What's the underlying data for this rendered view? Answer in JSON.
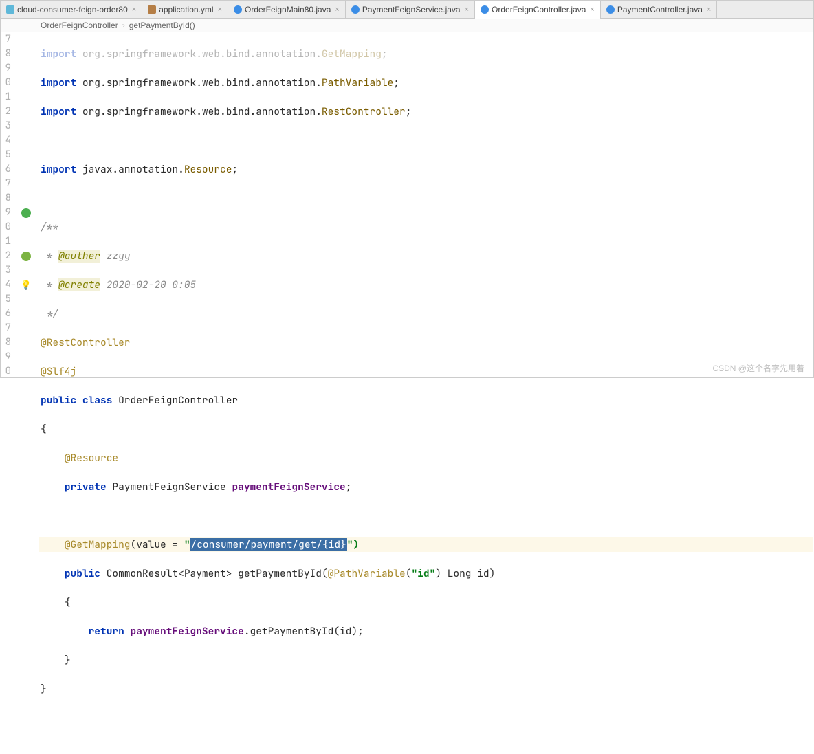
{
  "tabs": [
    {
      "label": "cloud-consumer-feign-order80",
      "icon": "module"
    },
    {
      "label": "application.yml",
      "icon": "yml"
    },
    {
      "label": "OrderFeignMain80.java",
      "icon": "java"
    },
    {
      "label": "PaymentFeignService.java",
      "icon": "java"
    },
    {
      "label": "OrderFeignController.java",
      "icon": "java",
      "active": true
    },
    {
      "label": "PaymentController.java",
      "icon": "java"
    }
  ],
  "breadcrumb": {
    "class": "OrderFeignController",
    "method": "getPaymentById()"
  },
  "lineStart": 7,
  "code": {
    "l7": {
      "kw": "import",
      "pkg": "org.springframework.web.bind.annotation.",
      "cls": "GetMapping"
    },
    "l8": {
      "kw": "import",
      "pkg": "org.springframework.web.bind.annotation.",
      "cls": "PathVariable"
    },
    "l9": {
      "kw": "import",
      "pkg": "org.springframework.web.bind.annotation.",
      "cls": "RestController"
    },
    "l11": {
      "kw": "import",
      "pkg": "javax.annotation.",
      "cls": "Resource"
    },
    "l13": "/**",
    "l14": {
      "tag": "@auther",
      "val": "zzyy"
    },
    "l15": {
      "tag": "@create",
      "val": "2020-02-20 0:05"
    },
    "l16": " */",
    "l17": "@RestController",
    "l18": "@Slf4j",
    "l19": {
      "kw1": "public",
      "kw2": "class",
      "name": "OrderFeignController"
    },
    "l20": "{",
    "l21": "@Resource",
    "l22": {
      "kw": "private",
      "type": "PaymentFeignService",
      "field": "paymentFeignService"
    },
    "l24": {
      "ann": "@GetMapping",
      "attr": "value = ",
      "strq": "\"",
      "sel": "/consumer/payment/get/{id}",
      "close": "\")"
    },
    "l25": {
      "kw": "public",
      "ret": "CommonResult<Payment>",
      "fn": "getPaymentById",
      "ann": "@PathVariable",
      "strq": "\"",
      "str": "id",
      "param": " Long id)"
    },
    "l26": "{",
    "l27": {
      "kw": "return",
      "field": "paymentFeignService",
      "call": ".getPaymentById(id);"
    },
    "l28": "}",
    "l29": "}"
  },
  "watermark": "CSDN @这个名字先用着"
}
